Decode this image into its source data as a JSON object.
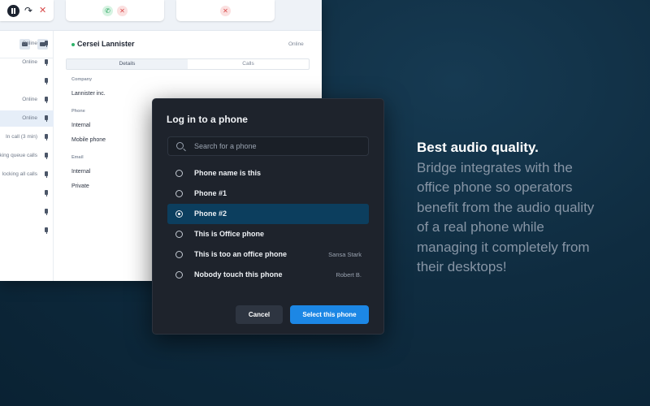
{
  "app": {
    "call_controls": {
      "pause_icon": "pause-icon",
      "forward_icon": "forward-arrow-icon",
      "forward_glyph": "↷",
      "hangup_glyph": "✕"
    },
    "call_cards": [
      {
        "accept_glyph": "✆",
        "reject_glyph": "✕"
      },
      {
        "reject_glyph": "✕"
      }
    ],
    "status_list": [
      {
        "text": "Online",
        "selected": false
      },
      {
        "text": "Online",
        "selected": false
      },
      {
        "text": "",
        "selected": false
      },
      {
        "text": "Online",
        "selected": false
      },
      {
        "text": "Online",
        "selected": true
      },
      {
        "text": "In call (3 min)",
        "selected": false
      },
      {
        "text": "king queue calls",
        "selected": false
      },
      {
        "text": "locking all calls",
        "selected": false
      },
      {
        "text": "",
        "selected": false
      },
      {
        "text": "",
        "selected": false
      },
      {
        "text": "",
        "selected": false
      }
    ],
    "contact": {
      "name": "Cersei Lannister",
      "status": "Online",
      "tabs": [
        "Details",
        "Calls"
      ],
      "sections": [
        {
          "label": "Company",
          "values": [
            "Lannister inc."
          ]
        },
        {
          "label": "Phone",
          "values": [
            "Internal",
            "Mobile phone"
          ]
        },
        {
          "label": "Email",
          "values": [
            "Internal",
            "Private"
          ]
        }
      ]
    }
  },
  "modal": {
    "title": "Log in to a phone",
    "search_placeholder": "Search for a phone",
    "search_value": "",
    "phones": [
      {
        "name": "Phone name is this",
        "owner": "",
        "selected": false
      },
      {
        "name": "Phone #1",
        "owner": "",
        "selected": false
      },
      {
        "name": "Phone #2",
        "owner": "",
        "selected": true
      },
      {
        "name": "This is Office phone",
        "owner": "",
        "selected": false
      },
      {
        "name": "This is too an office phone",
        "owner": "Sansa Stark",
        "selected": false
      },
      {
        "name": "Nobody touch this phone",
        "owner": "Robert B.",
        "selected": false
      }
    ],
    "cancel_label": "Cancel",
    "select_label": "Select this phone"
  },
  "promo": {
    "headline": "Best audio quality.",
    "body": "Bridge integrates with the office phone so operators benefit from the audio quality of a real phone while managing it completely from their desktops!"
  },
  "colors": {
    "accent": "#1c87e5",
    "selected_row": "#0c3e5e",
    "modal_bg": "#1e232c",
    "online_green": "#2fb36a",
    "hangup_red": "#d84a4a"
  }
}
